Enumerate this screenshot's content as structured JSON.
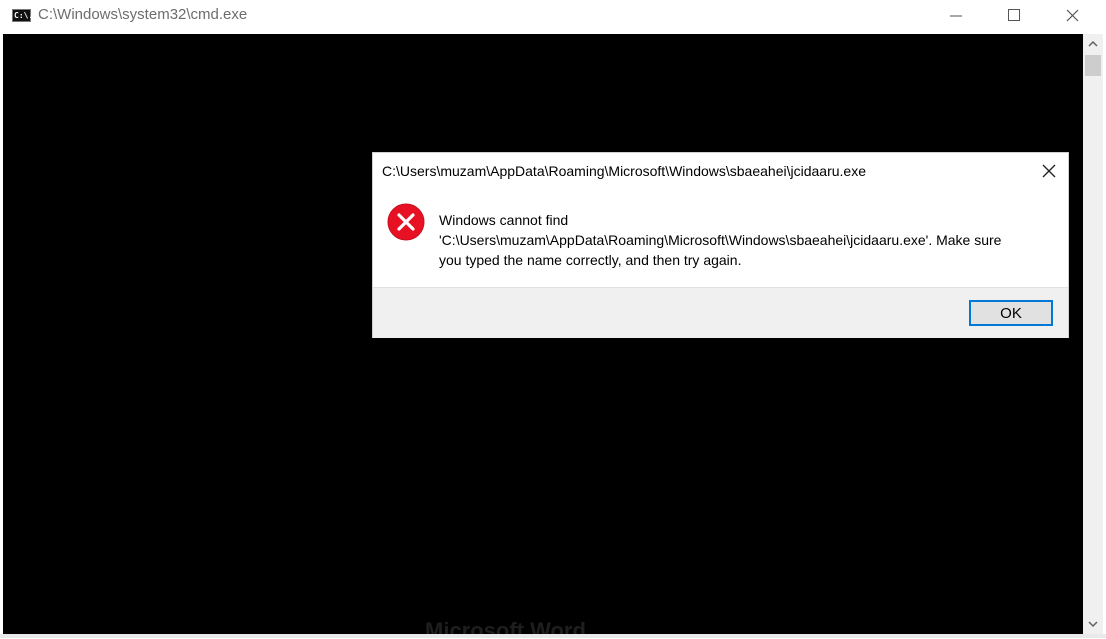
{
  "window": {
    "title": "C:\\Windows\\system32\\cmd.exe",
    "icon_label": "C:\\.",
    "controls": [
      "minimize-icon",
      "maximize-icon",
      "close-icon"
    ]
  },
  "console": {
    "background": "#000000",
    "ghost_text": "Microsoft Word"
  },
  "dialog": {
    "title": "C:\\Users\\muzam\\AppData\\Roaming\\Microsoft\\Windows\\sbaeahei\\jcidaaru.exe",
    "icon": "error-icon",
    "message_lines": [
      "Windows cannot find",
      "'C:\\Users\\muzam\\AppData\\Roaming\\Microsoft\\Windows\\sbaeahei\\jcidaaru.exe'. Make sure",
      "you typed the name correctly, and then try again."
    ],
    "ok_label": "OK",
    "accent_color": "#0078d7",
    "error_color": "#e81123"
  }
}
